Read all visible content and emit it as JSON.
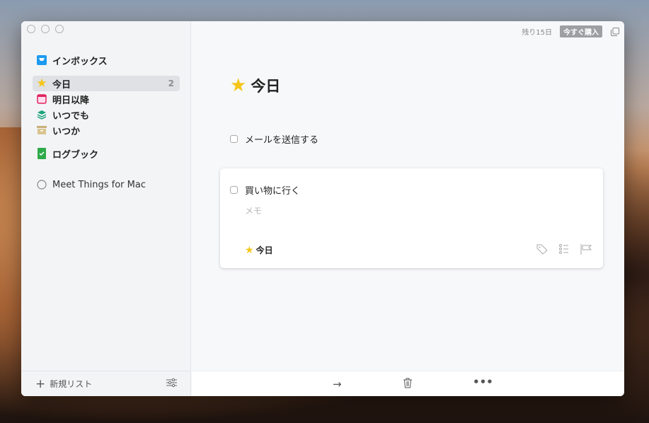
{
  "sidebar": {
    "items": [
      {
        "label": "インボックス",
        "icon": "inbox-icon"
      },
      {
        "label": "今日",
        "count": "2",
        "icon": "star-icon"
      },
      {
        "label": "明日以降",
        "icon": "calendar-icon"
      },
      {
        "label": "いつでも",
        "icon": "layers-icon"
      },
      {
        "label": "いつか",
        "icon": "archive-icon"
      },
      {
        "label": "ログブック",
        "icon": "logbook-icon"
      },
      {
        "label": "Meet Things for Mac",
        "icon": "circle-icon"
      }
    ],
    "new_list": "新規リスト"
  },
  "header": {
    "trial": "残り15日",
    "buy": "今すぐ購入"
  },
  "main": {
    "title": "今日",
    "todos": [
      {
        "label": "メールを送信する"
      }
    ],
    "card": {
      "label": "買い物に行く",
      "notes_placeholder": "メモ",
      "when": "今日"
    }
  },
  "colors": {
    "star": "#f5c518",
    "inbox": "#1d9bf0",
    "calendar": "#e0245e",
    "layers": "#1aa37a",
    "archive": "#c8b07a",
    "logbook": "#2eaa4a"
  }
}
